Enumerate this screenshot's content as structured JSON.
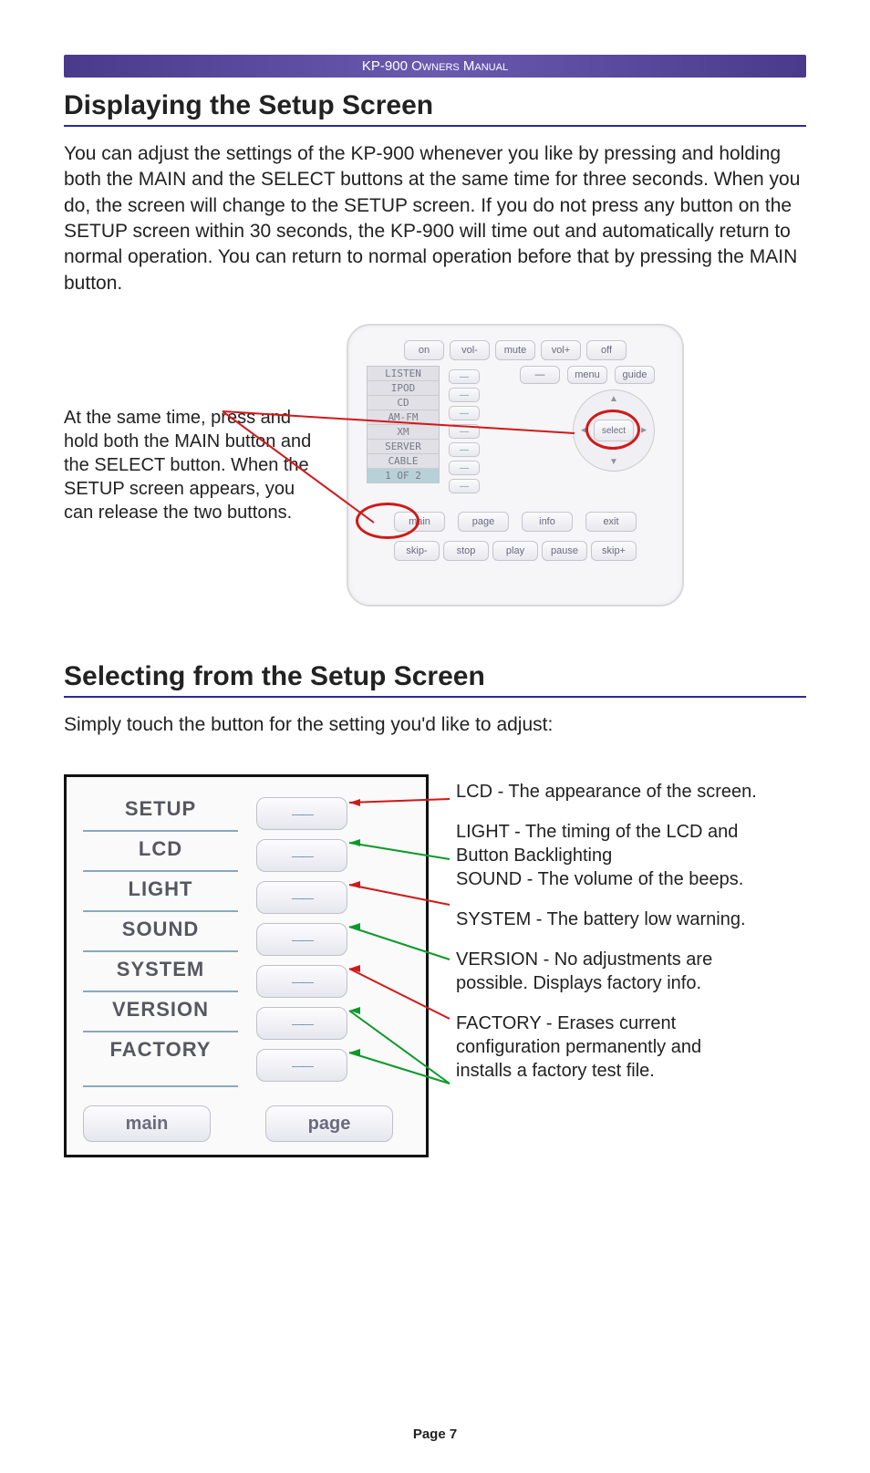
{
  "header": {
    "title": "KP-900 Owners Manual"
  },
  "section1": {
    "heading": "Displaying the Setup Screen",
    "body": "You can adjust the settings of the KP-900 whenever you like by pressing and holding both the MAIN and the SELECT buttons at the same time for three seconds. When you do, the screen will change to the SETUP screen. If you do not press any button on the SETUP screen within 30 seconds, the KP-900 will time out and automatically return to normal operation. You can return to normal operation before that by pressing the MAIN button.",
    "caption": "At the same time, press and hold both the MAIN button and the SELECT button. When the SETUP screen appears, you can release the two buttons."
  },
  "keypad": {
    "top": [
      "on",
      "vol-",
      "mute",
      "vol+",
      "off"
    ],
    "sources": [
      "LISTEN",
      "IPOD",
      "CD",
      "AM-FM",
      "XM",
      "SERVER",
      "CABLE",
      "1 OF 2"
    ],
    "menu": "menu",
    "guide": "guide",
    "select": "select",
    "mid": [
      "main",
      "page",
      "info",
      "exit"
    ],
    "bottom": [
      "skip-",
      "stop",
      "play",
      "pause",
      "skip+"
    ]
  },
  "section2": {
    "heading": "Selecting from the Setup Screen",
    "body": "Simply touch the button for the setting you'd like to adjust:"
  },
  "setup": {
    "labels": [
      "SETUP",
      "LCD",
      "LIGHT",
      "SOUND",
      "SYSTEM",
      "VERSION",
      "FACTORY"
    ],
    "nav": {
      "main": "main",
      "page": "page"
    }
  },
  "descriptions": {
    "lcd": "LCD - The appearance of the screen.",
    "light": "LIGHT - The timing of the LCD and Button Backlighting",
    "sound": "SOUND - The volume of the beeps.",
    "system": "SYSTEM - The battery low warning.",
    "version": "VERSION - No adjustments are possible. Displays factory info.",
    "factory": "FACTORY - Erases current configuration permanently and installs a factory test file."
  },
  "page": "Page 7"
}
